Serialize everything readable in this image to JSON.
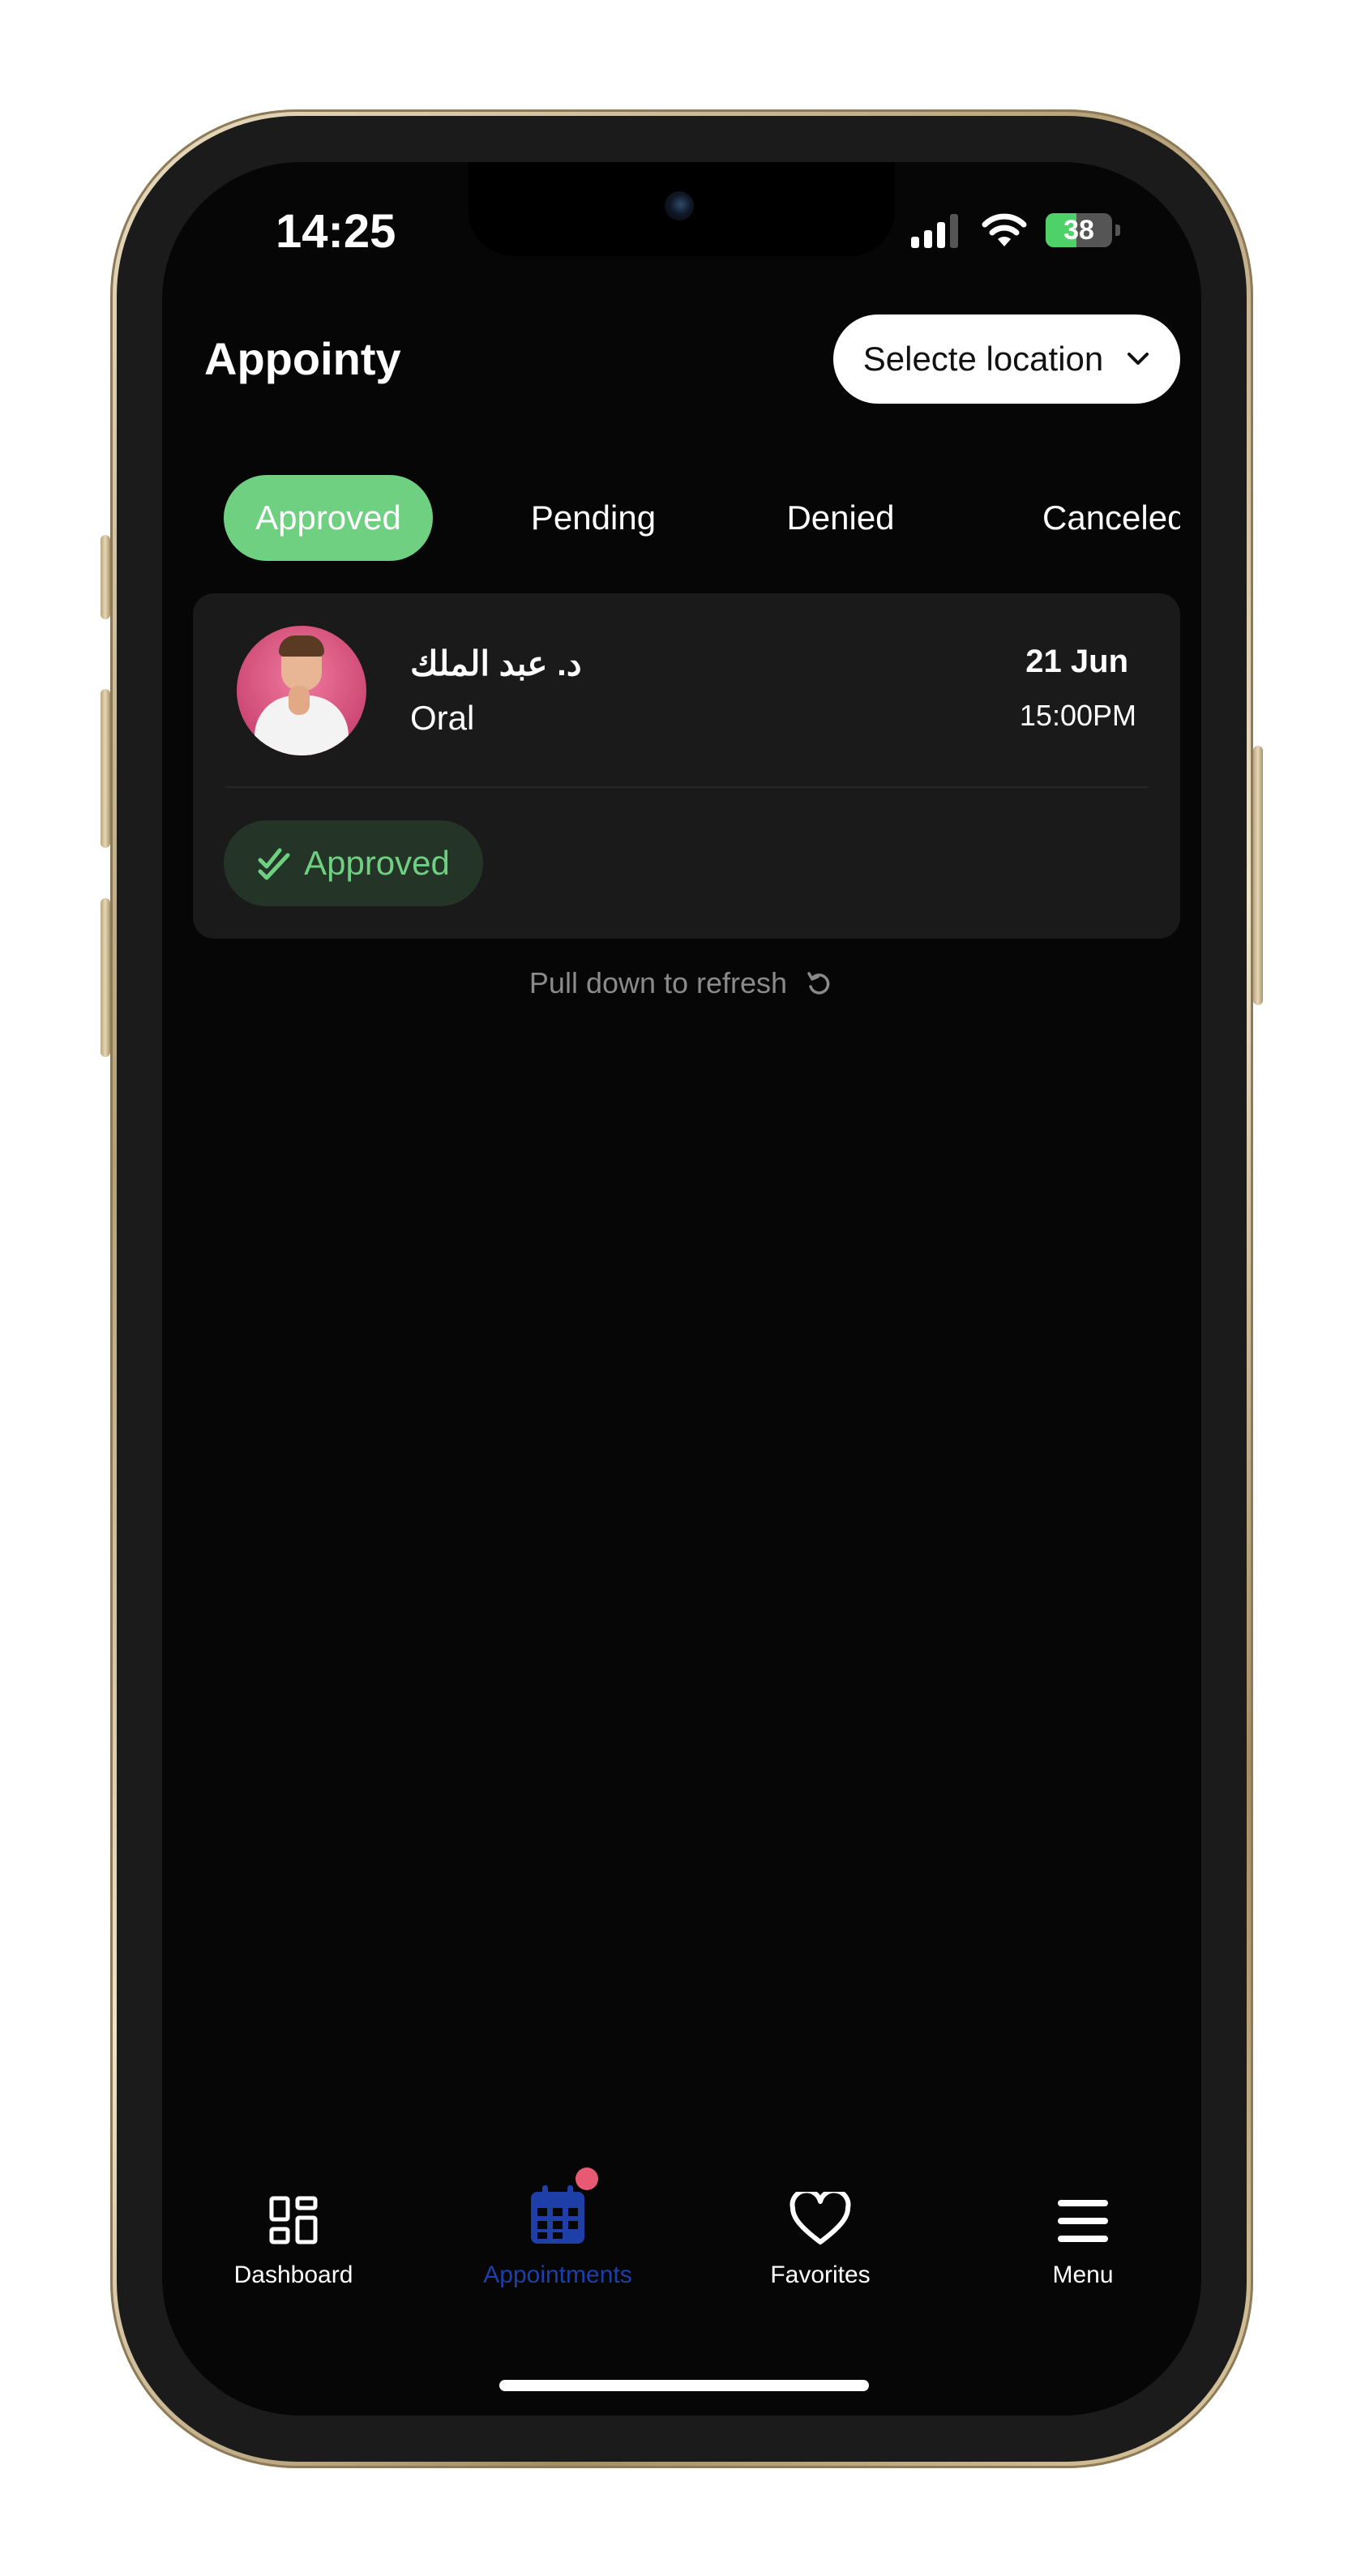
{
  "status_bar": {
    "time": "14:25",
    "battery": "38"
  },
  "header": {
    "title": "Appointy",
    "location_button": "Selecte location"
  },
  "tabs": [
    {
      "label": "Approved",
      "active": true
    },
    {
      "label": "Pending",
      "active": false
    },
    {
      "label": "Denied",
      "active": false
    },
    {
      "label": "Canceled",
      "active": false
    }
  ],
  "appointments": [
    {
      "doctor_name": "د. عبد الملك",
      "specialty": "Oral",
      "date": "21 Jun",
      "time": "15:00PM",
      "status": "Approved"
    }
  ],
  "refresh_hint": "Pull down to refresh",
  "bottom_nav": [
    {
      "label": "Dashboard",
      "icon": "dashboard-icon"
    },
    {
      "label": "Appointments",
      "icon": "calendar-icon",
      "active": true,
      "has_notification": true
    },
    {
      "label": "Favorites",
      "icon": "heart-icon"
    },
    {
      "label": "Menu",
      "icon": "menu-icon"
    }
  ],
  "colors": {
    "accent_green": "#6fd081",
    "active_nav_blue": "#1f3fa8",
    "notification_dot": "#e85a73",
    "background": "#060606"
  }
}
